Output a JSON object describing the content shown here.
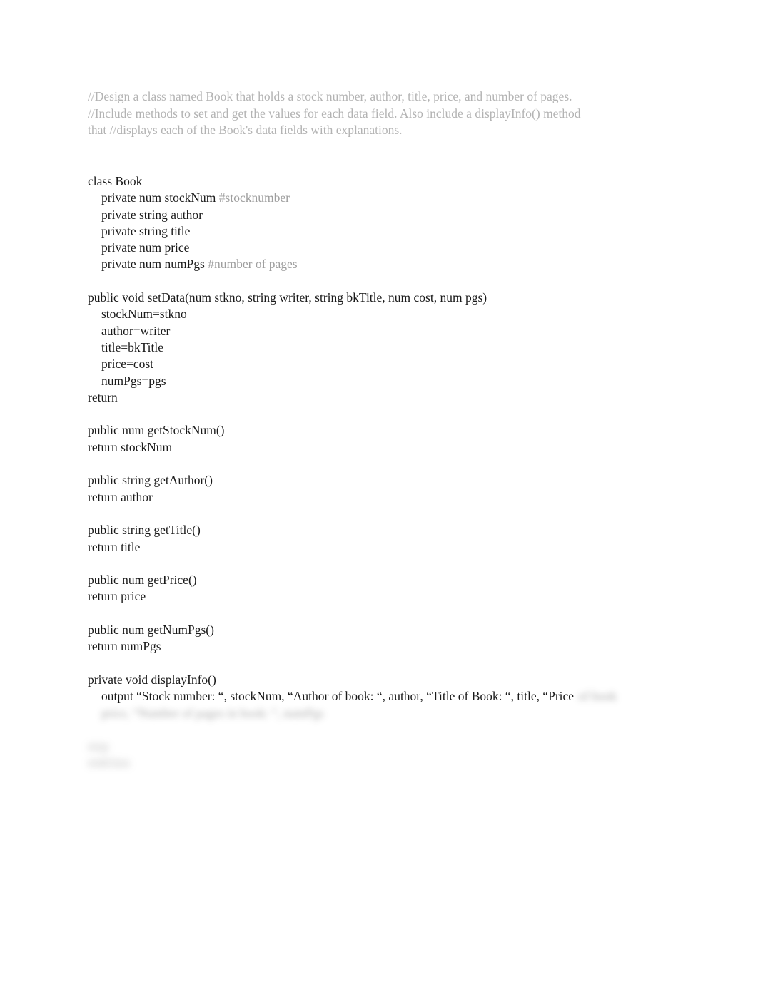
{
  "document": {
    "background_color": "#ffffff",
    "body_text_color": "#1a1a1a",
    "header_comment_color": "#b3b3b3",
    "inline_comment_color": "#9e9e9e"
  },
  "header_comment": {
    "lines": [
      "//Design a class named Book that holds a stock number, author, title, price, and number of pages.",
      "//Include methods to set and get the values for each data field. Also include a displayInfo() method",
      "that //displays each of the Book's data fields with explanations."
    ]
  },
  "code": {
    "class_declaration": "class Book",
    "fields": [
      {
        "text": "private num stockNum",
        "comment": "#stocknumber"
      },
      {
        "text": "private string author",
        "comment": ""
      },
      {
        "text": "private string title",
        "comment": ""
      },
      {
        "text": "private num price",
        "comment": ""
      },
      {
        "text": "private num numPgs",
        "comment": "#number of pages"
      }
    ],
    "set_data": {
      "signature": "public void setData(num stkno, string writer, string bkTitle, num cost, num pgs)",
      "assignments": [
        "stockNum=stkno",
        "author=writer",
        "title=bkTitle",
        "price=cost",
        "numPgs=pgs"
      ],
      "terminator": "return"
    },
    "getters": [
      {
        "signature": "public num getStockNum()",
        "body": "return stockNum"
      },
      {
        "signature": "public string getAuthor()",
        "body": "return author"
      },
      {
        "signature": "public string getTitle()",
        "body": "return title"
      },
      {
        "signature": "public num getPrice()",
        "body": "return price"
      },
      {
        "signature": "public num getNumPgs()",
        "body": "return numPgs"
      }
    ],
    "display_info": {
      "signature": "private void displayInfo()",
      "output_visible": "output “Stock number: “, stockNum, “Author of book: “, author, “Title of Book: “, title, “Price",
      "output_blurred_tail": "of book",
      "blurred_lines": [
        "price, “Number of pages in book: “, numPgs",
        "stop",
        "endclass"
      ]
    }
  }
}
